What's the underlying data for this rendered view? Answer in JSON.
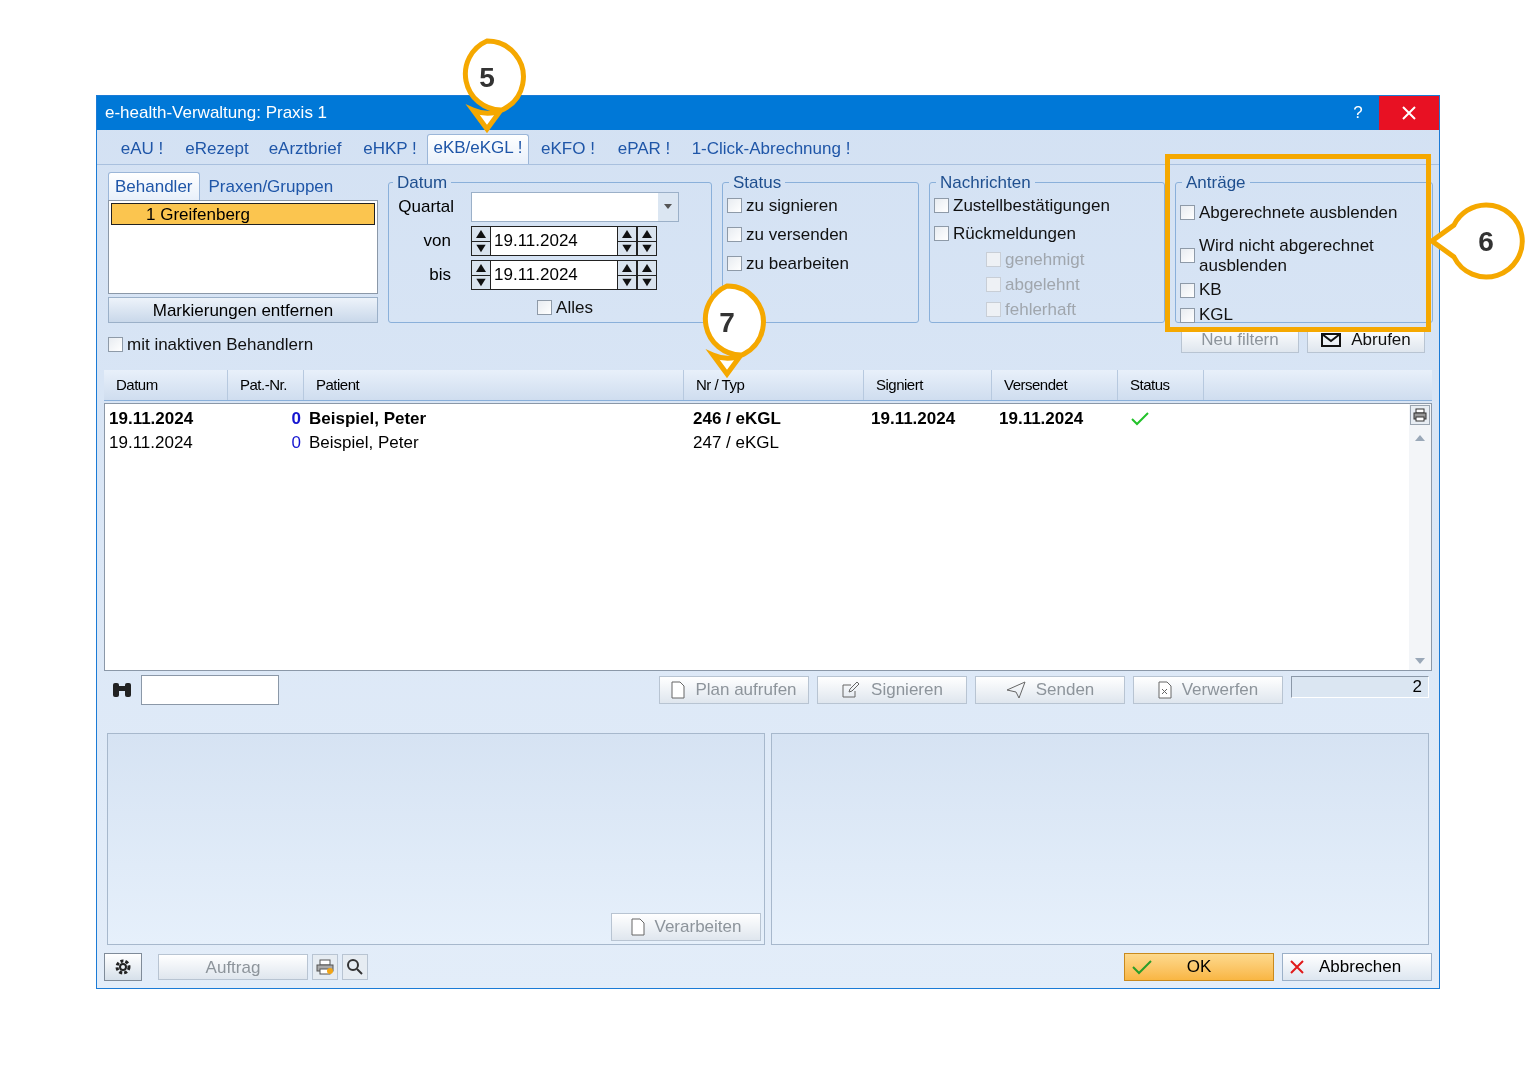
{
  "window": {
    "title": "e-health-Verwaltung: Praxis 1",
    "help": "?"
  },
  "tabs": [
    {
      "label": "eAU !",
      "selected": false
    },
    {
      "label": "eRezept",
      "selected": false
    },
    {
      "label": "eArztbrief",
      "selected": false
    },
    {
      "label": "eHKP !",
      "selected": false
    },
    {
      "label": "eKB/eKGL !",
      "selected": true
    },
    {
      "label": "eKFO !",
      "selected": false
    },
    {
      "label": "ePAR !",
      "selected": false
    },
    {
      "label": "1-Click-Abrechnung !",
      "selected": false
    }
  ],
  "behandler_panel": {
    "tabs": [
      {
        "label": "Behandler",
        "selected": true
      },
      {
        "label": "Praxen/Gruppen",
        "selected": false
      }
    ],
    "items": [
      {
        "label": "1 Greifenberg",
        "selected": true
      }
    ],
    "button": "Markierungen entfernen",
    "checkbox": {
      "label": "mit inaktiven Behandlern",
      "checked": false
    }
  },
  "datum": {
    "title": "Datum",
    "quartal_label": "Quartal",
    "von_label": "von",
    "von": "19.11.2024",
    "bis_label": "bis",
    "bis": "19.11.2024",
    "alles": {
      "label": "Alles",
      "checked": false
    }
  },
  "status": {
    "title": "Status",
    "options": [
      {
        "label": "zu signieren",
        "checked": false
      },
      {
        "label": "zu versenden",
        "checked": false
      },
      {
        "label": "zu bearbeiten",
        "checked": false
      }
    ]
  },
  "nachrichten": {
    "title": "Nachrichten",
    "options": [
      {
        "label": "Zustellbestätigungen",
        "checked": false,
        "disabled": false
      },
      {
        "label": "Rückmeldungen",
        "checked": false,
        "disabled": false,
        "children": [
          {
            "label": "genehmigt",
            "checked": false,
            "disabled": true
          },
          {
            "label": "abgelehnt",
            "checked": false,
            "disabled": true
          },
          {
            "label": "fehlerhaft",
            "checked": false,
            "disabled": true
          }
        ]
      }
    ]
  },
  "antraege": {
    "title": "Anträge",
    "options": [
      {
        "label": "Abgerechnete ausblenden",
        "checked": false
      },
      {
        "label": "Wird nicht abgerechnet ausblenden",
        "checked": false
      },
      {
        "label": "KB",
        "checked": false
      },
      {
        "label": "KGL",
        "checked": false
      }
    ]
  },
  "filter_buttons": [
    {
      "label": "Neu filtern",
      "disabled": true,
      "kind": "plain"
    },
    {
      "label": "Abrufen",
      "disabled": false,
      "kind": "mail"
    }
  ],
  "table": {
    "columns": [
      "Datum",
      "Pat.-Nr.",
      "Patient",
      "Nr / Typ",
      "Signiert",
      "Versendet",
      "Status"
    ],
    "rows": [
      {
        "cells": [
          "19.11.2024",
          "0",
          "Beispiel, Peter",
          "246 / eKGL",
          "19.11.2024",
          "19.11.2024"
        ],
        "bold": true,
        "status_ok": true
      },
      {
        "cells": [
          "19.11.2024",
          "0",
          "Beispiel, Peter",
          "247 / eKGL",
          "",
          ""
        ],
        "bold": false,
        "status_ok": false
      }
    ]
  },
  "toolbar": {
    "buttons": [
      {
        "label": "Plan aufrufen",
        "disabled": true,
        "kind": "doc"
      },
      {
        "label": "Signieren",
        "disabled": true,
        "kind": "pencil"
      },
      {
        "label": "Senden",
        "disabled": true,
        "kind": "send"
      },
      {
        "label": "Verwerfen",
        "disabled": true,
        "kind": "discard"
      }
    ],
    "count": "2"
  },
  "verarbeiten": {
    "label": "Verarbeiten",
    "disabled": true
  },
  "bottom": {
    "auftrag": {
      "label": "Auftrag",
      "disabled": true
    },
    "ok": "OK",
    "cancel": "Abbrechen"
  },
  "callouts": [
    {
      "label": "5"
    },
    {
      "label": "6"
    },
    {
      "label": "7"
    }
  ]
}
